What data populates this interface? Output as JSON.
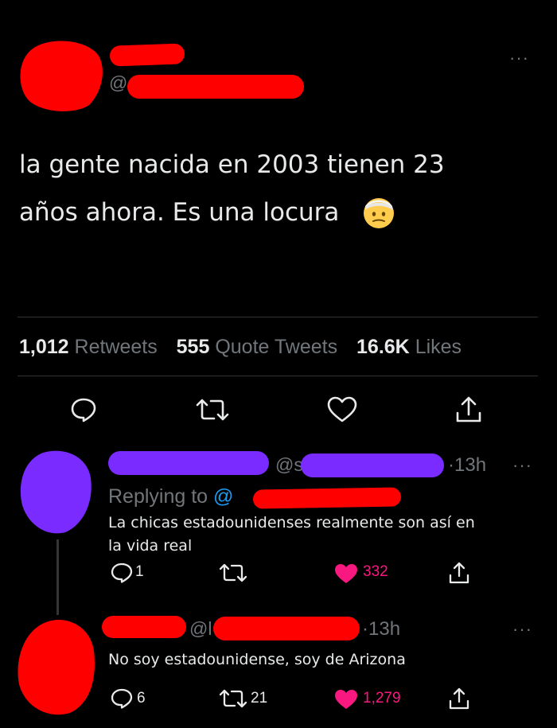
{
  "main_tweet": {
    "handle_prefix": "@",
    "text_line1": "la gente nacida en 2003 tienen 23",
    "text_line2": "años ahora. Es una locura",
    "emoji_icon": "face-with-head-bandage-icon",
    "stats": {
      "retweets_count": "1,012",
      "retweets_label": "Retweets",
      "quotes_count": "555",
      "quotes_label": "Quote Tweets",
      "likes_count": "16.6K",
      "likes_label": "Likes"
    }
  },
  "reply1": {
    "handle_prefix": "@s",
    "time": "13h",
    "replying_label": "Replying to",
    "replying_handle_prefix": "@",
    "text_line1": "La chicas estadounidenses realmente son así en",
    "text_line2": "la vida real",
    "reply_count": "1",
    "retweet_count": "",
    "like_count": "332",
    "colors": {
      "like": "#f91880",
      "redaction": "#ff0000",
      "purple": "#7a2bff"
    }
  },
  "reply2": {
    "handle_prefix": "@l",
    "time": "13h",
    "text": "No soy estadounidense, soy de Arizona",
    "reply_count": "6",
    "retweet_count": "21",
    "like_count": "1,279"
  },
  "more_glyph": "···",
  "dot_separator": "·"
}
